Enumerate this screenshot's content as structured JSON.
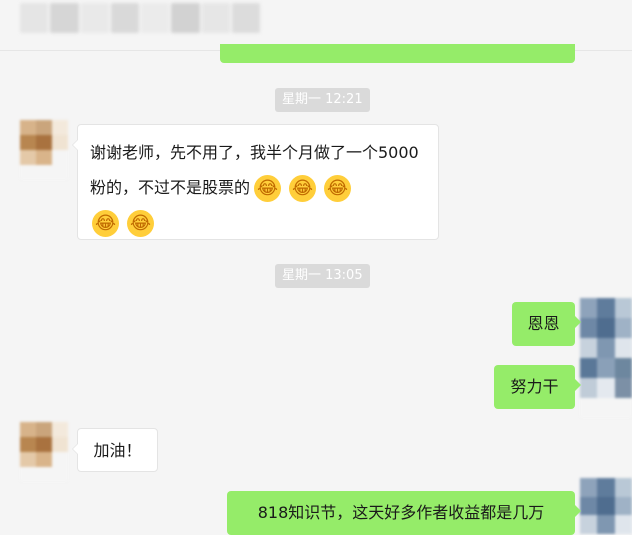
{
  "header": {
    "title_icon": "blurred-title"
  },
  "messages": [
    {
      "type": "time",
      "text": "星期一 12:21"
    },
    {
      "type": "received",
      "text": "谢谢老师，先不用了，我半个月做了一个5000粉的，不过不是股票的",
      "emojis": [
        "laughing-tears-emoji",
        "laughing-tears-emoji",
        "laughing-tears-emoji",
        "laughing-tears-emoji",
        "laughing-tears-emoji"
      ]
    },
    {
      "type": "time",
      "text": "星期一 13:05"
    },
    {
      "type": "sent",
      "text": "恩恩"
    },
    {
      "type": "sent",
      "text": "努力干"
    },
    {
      "type": "received",
      "text": "加油！"
    },
    {
      "type": "sent",
      "text": "818知识节，这天好多作者收益都是几万"
    }
  ],
  "colors": {
    "sent_bubble": "#95ec69",
    "received_bubble": "#ffffff",
    "background": "#f5f5f5",
    "time_pill": "#dadada"
  }
}
